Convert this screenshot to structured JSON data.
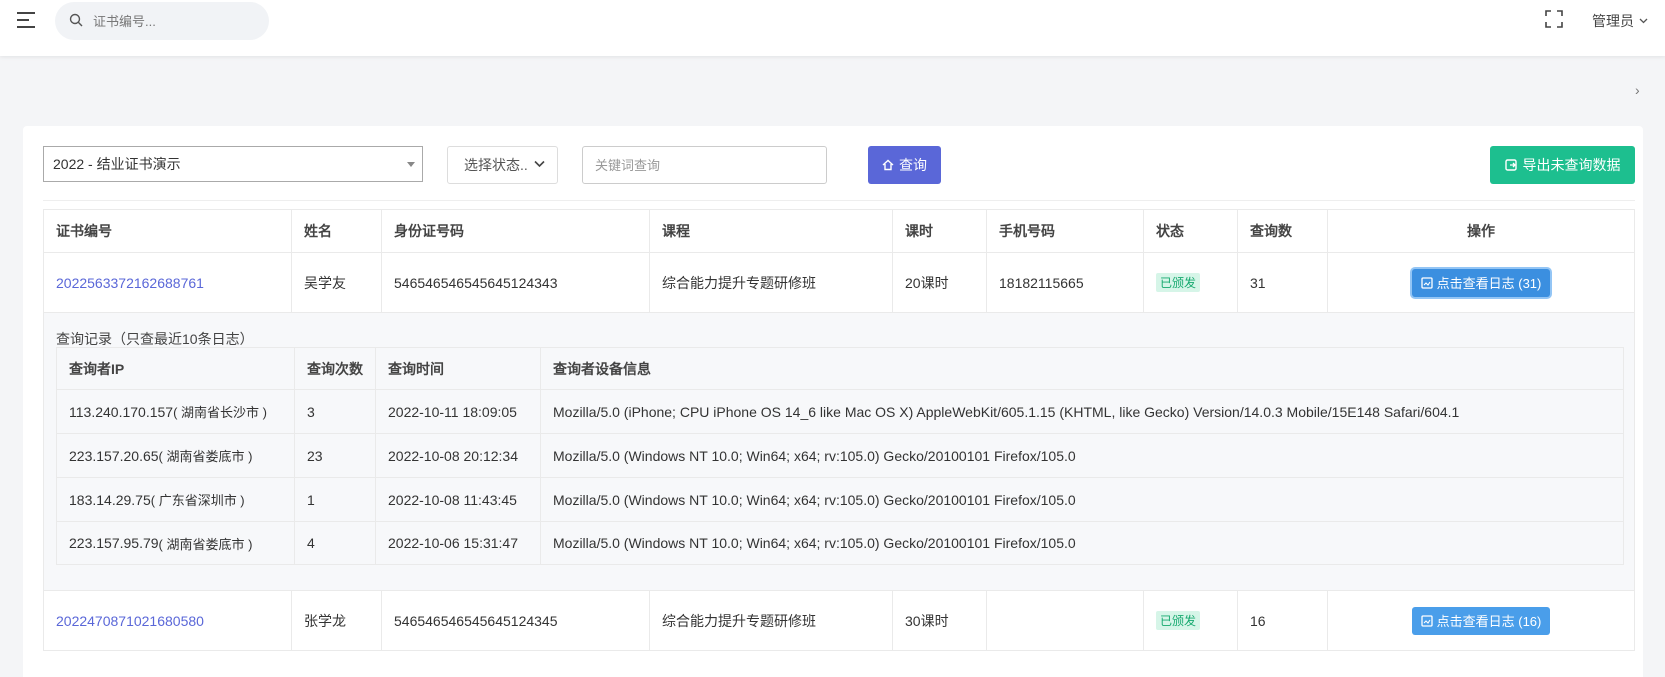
{
  "header": {
    "search_placeholder": "证书编号...",
    "user_label": "管理员"
  },
  "filters": {
    "cert_type": "2022 - 结业证书演示",
    "status_placeholder": "选择状态..",
    "keyword_placeholder": "关键词查询",
    "query_label": "查询",
    "export_label": "导出未查询数据"
  },
  "table": {
    "headers": [
      "证书编号",
      "姓名",
      "身份证号码",
      "课程",
      "课时",
      "手机号码",
      "状态",
      "查询数",
      "操作"
    ],
    "rows": [
      {
        "cert_no": "2022563372162688761",
        "name": "吴学友",
        "id_no": "546546546545645124343",
        "course": "综合能力提升专题研修班",
        "hours": "20课时",
        "phone": "18182115665",
        "status": "已颁发",
        "queries": "31",
        "action": "点击查看日志 (31)"
      },
      {
        "cert_no": "2022470871021680580",
        "name": "张学龙",
        "id_no": "546546546545645124345",
        "course": "综合能力提升专题研修班",
        "hours": "30课时",
        "phone": "",
        "status": "已颁发",
        "queries": "16",
        "action": "点击查看日志 (16)"
      }
    ]
  },
  "log": {
    "title": "查询记录（只查最近10条日志）",
    "headers": [
      "查询者IP",
      "查询次数",
      "查询时间",
      "查询者设备信息"
    ],
    "rows": [
      {
        "ip": "113.240.170.157",
        "loc": "( 湖南省长沙市 )",
        "count": "3",
        "time": "2022-10-11 18:09:05",
        "ua": "Mozilla/5.0 (iPhone; CPU iPhone OS 14_6 like Mac OS X) AppleWebKit/605.1.15 (KHTML, like Gecko) Version/14.0.3 Mobile/15E148 Safari/604.1"
      },
      {
        "ip": "223.157.20.65",
        "loc": "( 湖南省娄底市 )",
        "count": "23",
        "time": "2022-10-08 20:12:34",
        "ua": "Mozilla/5.0 (Windows NT 10.0; Win64; x64; rv:105.0) Gecko/20100101 Firefox/105.0"
      },
      {
        "ip": "183.14.29.75",
        "loc": "( 广东省深圳市 )",
        "count": "1",
        "time": "2022-10-08 11:43:45",
        "ua": "Mozilla/5.0 (Windows NT 10.0; Win64; x64; rv:105.0) Gecko/20100101 Firefox/105.0"
      },
      {
        "ip": "223.157.95.79",
        "loc": "( 湖南省娄底市 )",
        "count": "4",
        "time": "2022-10-06 15:31:47",
        "ua": "Mozilla/5.0 (Windows NT 10.0; Win64; x64; rv:105.0) Gecko/20100101 Firefox/105.0"
      }
    ]
  },
  "colors": {
    "primary": "#5a67d8",
    "success": "#1dbf8f",
    "info_button": "#3b8fe0",
    "badge_text": "#16a96f"
  }
}
